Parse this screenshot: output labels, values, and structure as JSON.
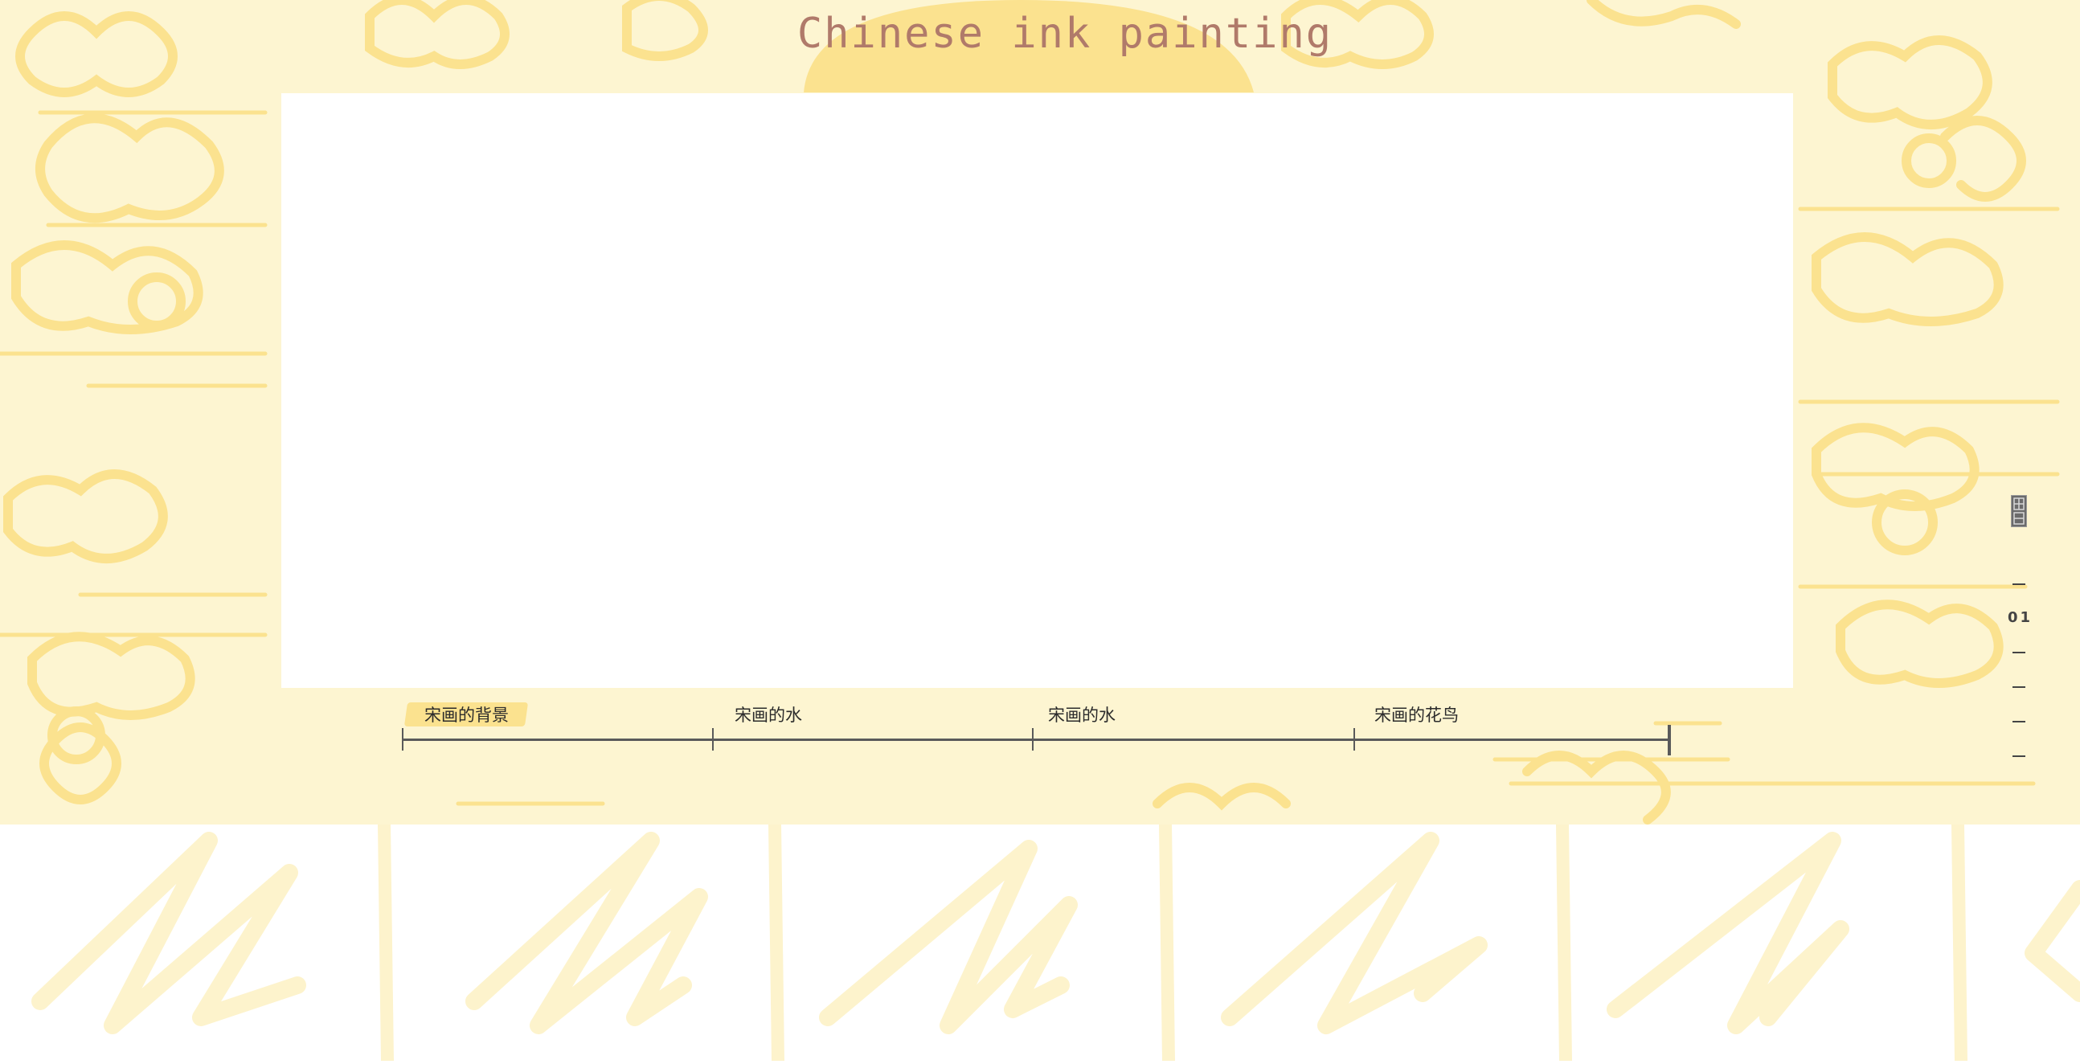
{
  "page": {
    "title": "Chinese ink painting"
  },
  "timeline": {
    "items": [
      {
        "label": "宋画的背景",
        "active": true
      },
      {
        "label": "宋画的水",
        "active": false
      },
      {
        "label": "宋画的水",
        "active": false
      },
      {
        "label": "宋画的花鸟",
        "active": false
      }
    ]
  },
  "side_nav": {
    "current": "01",
    "seal_icon": "seal-stamp-icon"
  },
  "colors": {
    "background": "#fdf5d1",
    "cloud": "#fbe28f",
    "title": "#b07a6a",
    "timeline": "#5a5a5a",
    "brush": "#fdf3cc"
  }
}
